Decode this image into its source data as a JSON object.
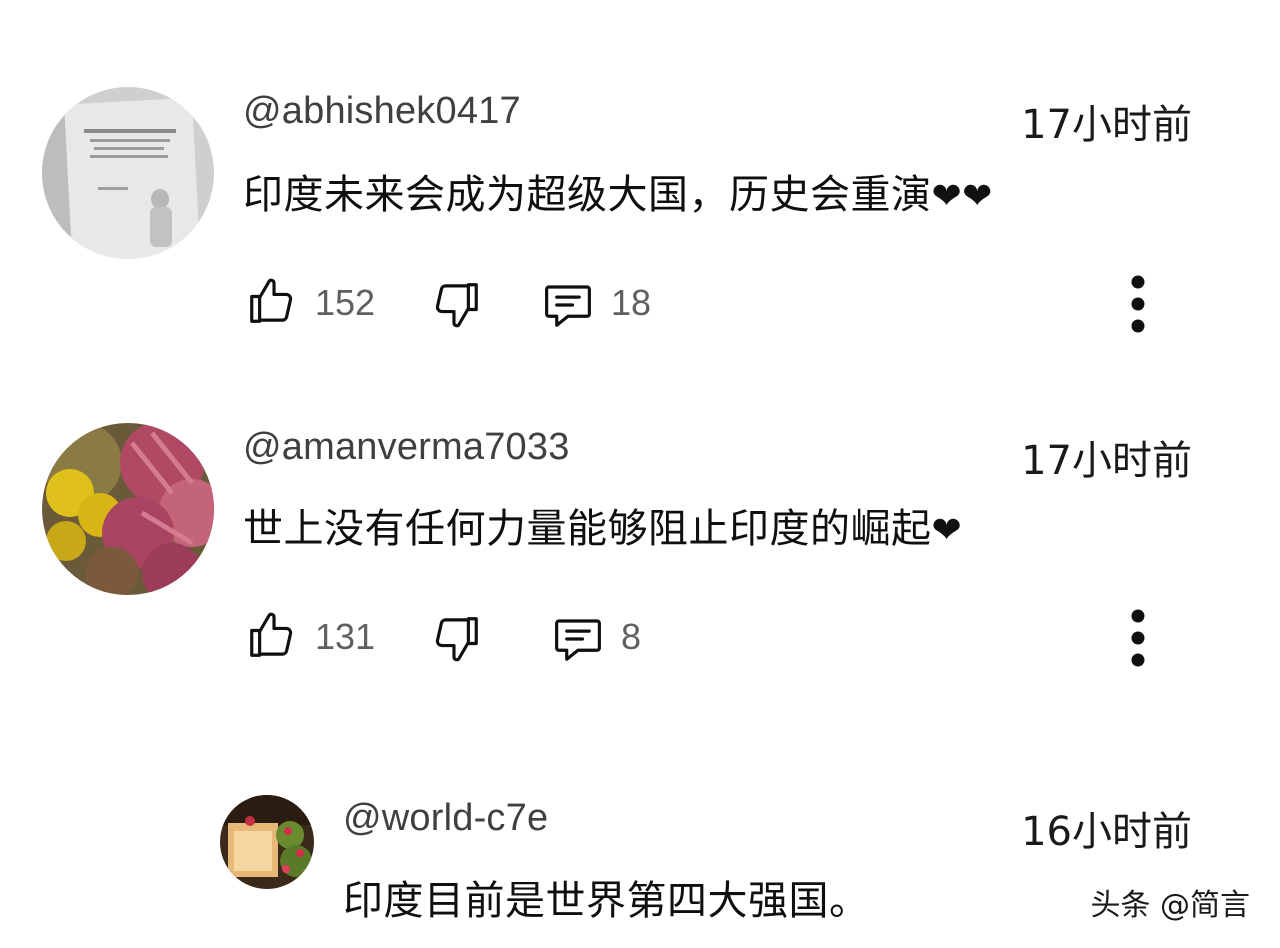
{
  "comments": [
    {
      "username": "@abhishek0417",
      "time": "17小时前",
      "text": "印度未来会成为超级大国，历史会重演",
      "hearts": "❤❤",
      "likes": "152",
      "replies": "18"
    },
    {
      "username": "@amanverma7033",
      "time": "17小时前",
      "text": "世上没有任何力量能够阻止印度的崛起",
      "hearts": "❤",
      "likes": "131",
      "replies": "8"
    },
    {
      "username": "@world-c7e",
      "time": "16小时前",
      "text": "印度目前是世界第四大强国。"
    }
  ],
  "watermark": "头条 @简言",
  "icons": {
    "like": "thumbs-up-icon",
    "dislike": "thumbs-down-icon",
    "reply": "comment-icon",
    "more": "more-vertical-icon"
  },
  "colors": {
    "text": "#0f0f0f",
    "secondary": "#606060",
    "username": "#404040"
  }
}
